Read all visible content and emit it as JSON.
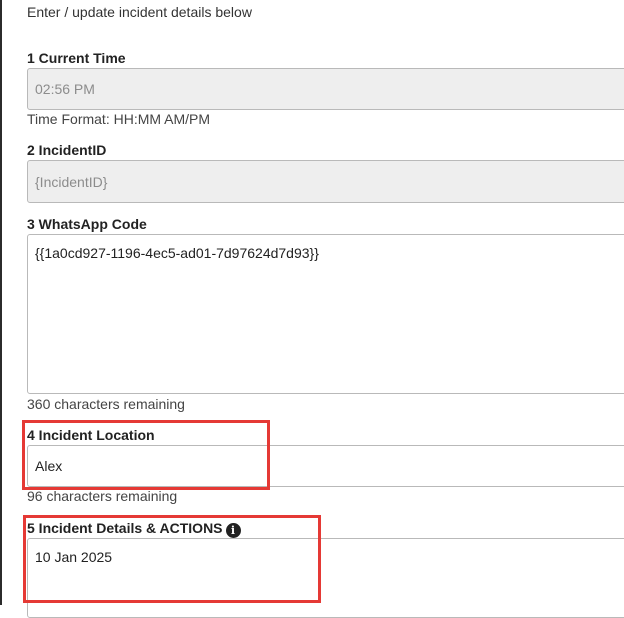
{
  "intro": "Enter / update incident details below",
  "fields": {
    "current_time": {
      "label": "1 Current Time",
      "value": "02:56 PM",
      "hint": "Time Format: HH:MM AM/PM"
    },
    "incident_id": {
      "label": "2 IncidentID",
      "value": "{IncidentID}"
    },
    "whatsapp_code": {
      "label": "3 WhatsApp Code",
      "value": "{{1a0cd927-1196-4ec5-ad01-7d97624d7d93}}",
      "hint": "360 characters remaining"
    },
    "incident_location": {
      "label": "4 Incident Location",
      "value": "Alex",
      "hint": "96 characters remaining"
    },
    "incident_details": {
      "label": "5 Incident Details & ACTIONS",
      "value": "10 Jan 2025"
    }
  },
  "icons": {
    "info": "info-circle-icon"
  },
  "colors": {
    "highlight": "#e53935",
    "disabled_bg": "#eeeeee"
  }
}
